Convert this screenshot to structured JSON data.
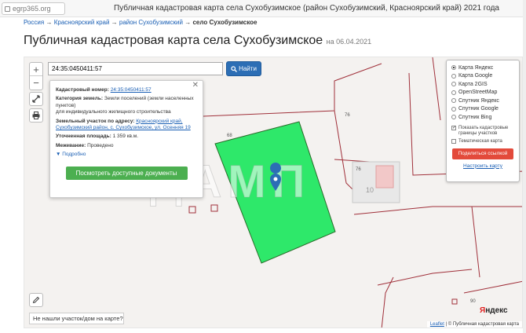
{
  "browser": {
    "address": "egrp365.org",
    "title": "Публичная кадастровая карта села Сухобузимское (район Сухобузимский, Красноярский край) 2021 года"
  },
  "breadcrumbs": {
    "items": [
      "Россия",
      "Красноярский край",
      "район Сухобузимский"
    ],
    "current": "село Сухобузимское",
    "separator": "→"
  },
  "page": {
    "title": "Публичная кадастровая карта села Сухобузимское",
    "date": "на 06.04.2021"
  },
  "map": {
    "zoom_in": "+",
    "zoom_out": "−",
    "search": {
      "value": "24:35:0450411:57",
      "button": "Найти"
    },
    "parcel_labels": [
      "68",
      "76",
      "76",
      "10",
      "90"
    ],
    "watermark": "ДАМП",
    "not_found": "Не нашли участок/дом на карте?",
    "yandex_logo": {
      "a": "Я",
      "b": "ндекс"
    },
    "attribution": {
      "leaflet": "Leaflet",
      "source": "© Публичная кадастровая карта"
    }
  },
  "popup": {
    "close": "✕",
    "cad_num_label": "Кадастровый номер:",
    "cad_num_value": "24:35:0450411:57",
    "category_label": "Категория земель:",
    "category_value": "Земли поселений (земли населенных пунктов)",
    "category_use": "для индивидуального жилищного строительства",
    "address_label": "Земельный участок по адресу:",
    "address_value": "Красноярский край, Сухобузимский район, с. Сухобузимское, ул. Осенняя 19",
    "area_label": "Уточненная площадь:",
    "area_value": "1 359 кв.м.",
    "survey_label": "Межевание:",
    "survey_value": "Проведено",
    "more": "Подробно",
    "docs_button": "Посмотреть доступные документы"
  },
  "layers": {
    "options": [
      {
        "label": "Карта Яндекс",
        "selected": true
      },
      {
        "label": "Карта Google",
        "selected": false
      },
      {
        "label": "Карта 2GIS",
        "selected": false
      },
      {
        "label": "OpenStreetMap",
        "selected": false
      },
      {
        "label": "Спутник Яндекс",
        "selected": false
      },
      {
        "label": "Спутник Google",
        "selected": false
      },
      {
        "label": "Спутник Bing",
        "selected": false
      }
    ],
    "show_borders": "Показать кадастровые границы участков",
    "thematic": "Тематическая карта",
    "share": "Поделиться ссылкой",
    "setup": "Настроить карту"
  },
  "colors": {
    "parcel_fill": "#2ee86a",
    "parcel_border": "#2a6b2a",
    "boundary": "#a0303a",
    "accent": "#2c6eb5",
    "share": "#e34a3b"
  }
}
